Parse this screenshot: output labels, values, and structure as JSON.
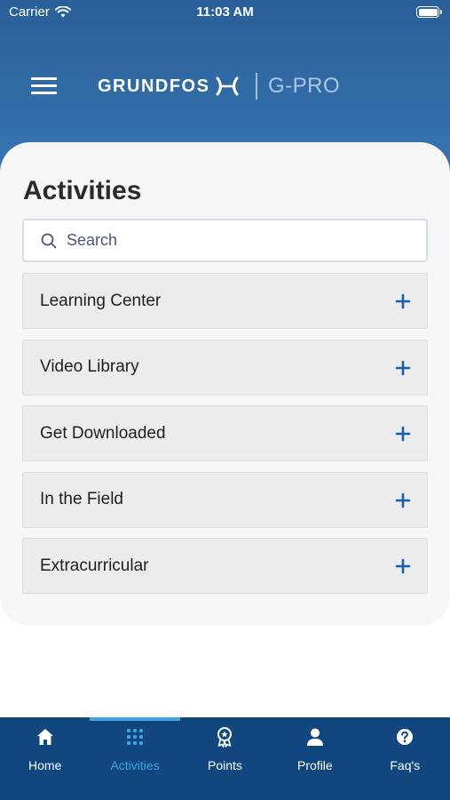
{
  "status": {
    "carrier": "Carrier",
    "time": "11:03 AM"
  },
  "header": {
    "brand": "GRUNDFOS",
    "product": "G-PRO",
    "menu_icon": "hamburger-icon"
  },
  "main": {
    "title": "Activities",
    "search": {
      "placeholder": "Search",
      "value": ""
    },
    "sections": [
      {
        "label": "Learning Center"
      },
      {
        "label": "Video Library"
      },
      {
        "label": "Get Downloaded"
      },
      {
        "label": "In the Field"
      },
      {
        "label": "Extracurricular"
      }
    ]
  },
  "tabs": [
    {
      "label": "Home",
      "icon": "home-icon",
      "active": false
    },
    {
      "label": "Activities",
      "icon": "grid-icon",
      "active": true
    },
    {
      "label": "Points",
      "icon": "award-icon",
      "active": false
    },
    {
      "label": "Profile",
      "icon": "user-icon",
      "active": false
    },
    {
      "label": "Faq's",
      "icon": "help-icon",
      "active": false
    }
  ],
  "colors": {
    "header": "#2a5f99",
    "tabbar": "#11467f",
    "accent": "#3fa4e4",
    "plus": "#1a5fa8"
  }
}
